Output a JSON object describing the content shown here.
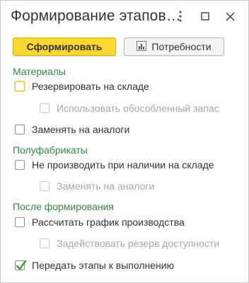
{
  "window": {
    "title": "Формирование этапов…"
  },
  "titlebar_icons": [
    "more-options-icon",
    "maximize-icon",
    "close-icon"
  ],
  "toolbar": {
    "primary_label": "Сформировать",
    "secondary_label": "Потребности",
    "secondary_icon": "bar-chart-icon"
  },
  "groups": {
    "materials": {
      "title": "Материалы",
      "reserve": {
        "label": "Резервировать на складе",
        "checked": false
      },
      "use_separate": {
        "label": "Использовать обособленный запас",
        "checked": false,
        "disabled": true
      },
      "replace": {
        "label": "Заменять на аналоги",
        "checked": false
      }
    },
    "semi": {
      "title": "Полуфабрикаты",
      "no_produce": {
        "label": "Не производить при наличии на складе",
        "checked": false
      },
      "replace": {
        "label": "Заменять на аналоги",
        "checked": false,
        "disabled": true
      }
    },
    "after": {
      "title": "После формирования",
      "schedule": {
        "label": "Рассчитать график производства",
        "checked": false
      },
      "use_reserve": {
        "label": "Задействовать резерв доступности",
        "checked": false,
        "disabled": true
      },
      "transfer": {
        "label": "Передать этапы к выполнению",
        "checked": true
      }
    }
  },
  "colors": {
    "accent_green": "#2e8b3a",
    "primary_button": "#fcd832",
    "check_green": "#3a9d3a"
  }
}
